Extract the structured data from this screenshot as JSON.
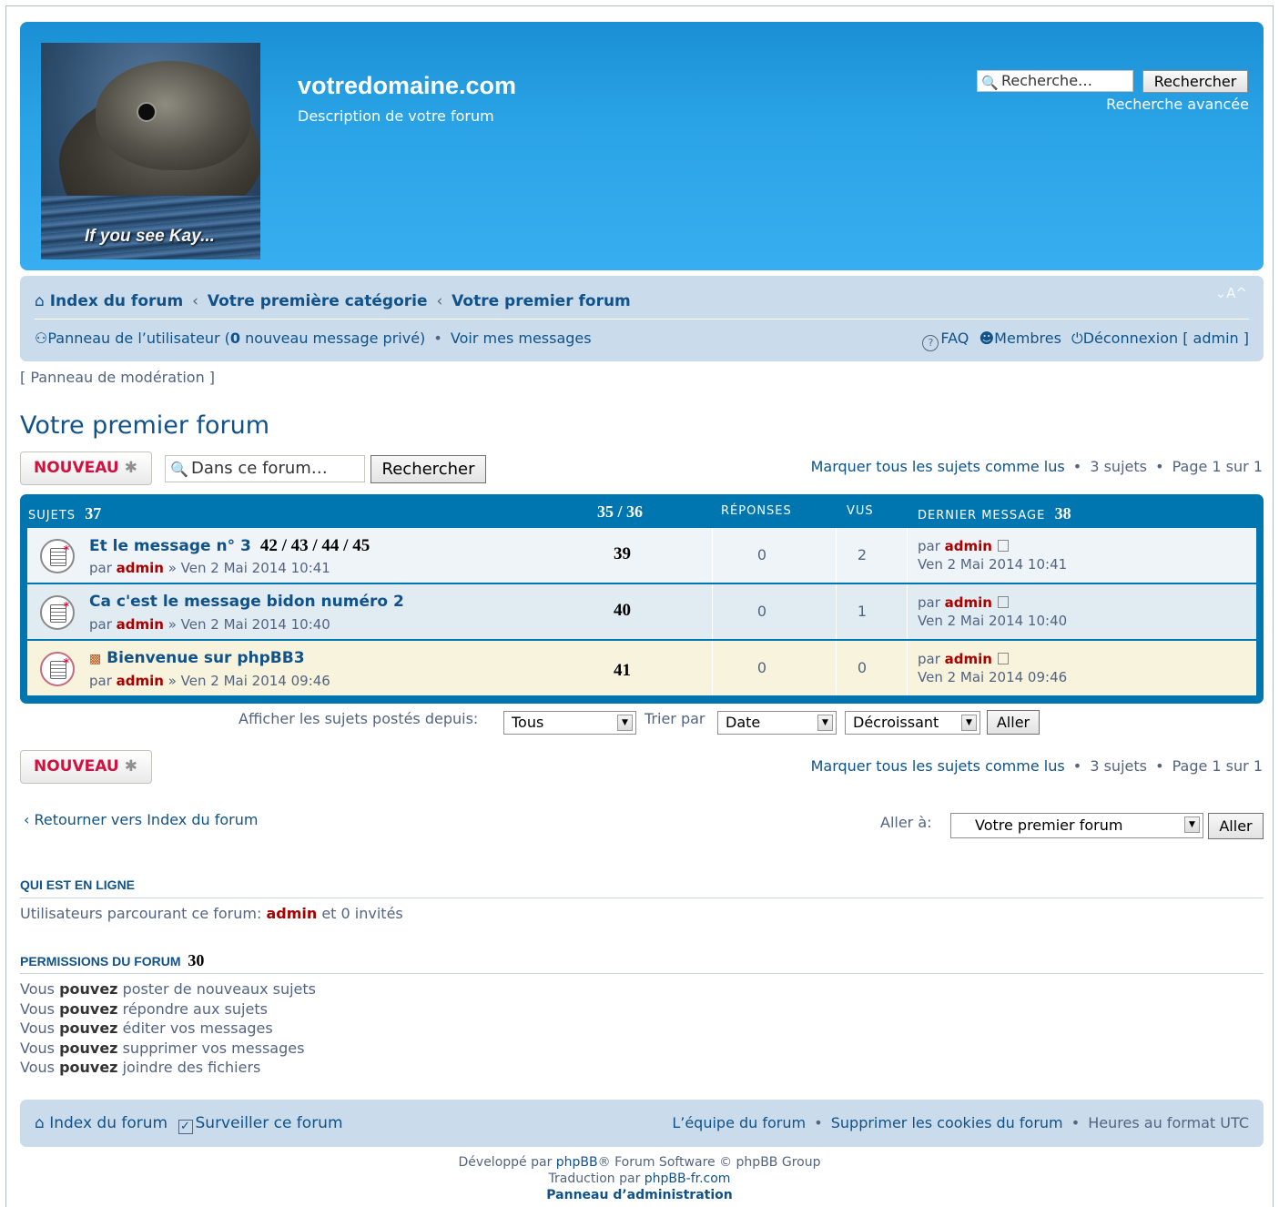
{
  "header": {
    "site_title": "votredomaine.com",
    "site_description": "Description de votre forum",
    "logo_caption": "If you see Kay...",
    "search_placeholder": "Recherche…",
    "search_button": "Rechercher",
    "advanced_search": "Recherche avancée"
  },
  "breadcrumbs": [
    "Index du forum",
    "Votre première catégorie",
    "Votre premier forum"
  ],
  "font_size_control": "⌄A^",
  "navbar": {
    "user_panel": "Panneau de l’utilisateur (",
    "pm_count": "0",
    "pm_text": " nouveau message privé)",
    "my_posts": "Voir mes messages",
    "faq": "FAQ",
    "members": "Membres",
    "logout": "Déconnexion [ admin ]"
  },
  "moderation_panel": "[ Panneau de modération ]",
  "forum": {
    "title": "Votre premier forum",
    "new_button": "NOUVEAU",
    "search_placeholder": "Dans ce forum…",
    "search_button": "Rechercher",
    "mark_read": "Marquer tous les sujets comme lus",
    "topics_count": "3 sujets",
    "page_info": "Page 1 sur 1"
  },
  "table": {
    "col_topics": "SUJETS",
    "col_topics_num": "37",
    "col_pages": "35 / 36",
    "col_replies": "RÉPONSES",
    "col_views": "VUS",
    "col_last": "DERNIER MESSAGE",
    "col_last_num": "38",
    "rows": [
      {
        "title": "Et le message n° 3",
        "pages": "42 / 43 / 44 / 45",
        "by": "par ",
        "author": "admin",
        "date": " » Ven 2 Mai 2014 10:41",
        "num": "39",
        "replies": "0",
        "views": "2",
        "last_by": "par ",
        "last_author": "admin",
        "last_date": "Ven 2 Mai 2014 10:41"
      },
      {
        "title": "Ca c'est le message bidon numéro 2",
        "pages": "",
        "by": "par ",
        "author": "admin",
        "date": " » Ven 2 Mai 2014 10:40",
        "num": "40",
        "replies": "0",
        "views": "1",
        "last_by": "par ",
        "last_author": "admin",
        "last_date": "Ven 2 Mai 2014 10:40"
      },
      {
        "title": "Bienvenue sur phpBB3",
        "pages": "",
        "by": "par ",
        "author": "admin",
        "date": " » Ven 2 Mai 2014 09:46",
        "num": "41",
        "replies": "0",
        "views": "0",
        "last_by": "par ",
        "last_author": "admin",
        "last_date": "Ven 2 Mai 2014 09:46"
      }
    ]
  },
  "sorting": {
    "show_since_label": "Afficher les sujets postés depuis:",
    "show_since_value": "Tous",
    "sort_by_label": "Trier par",
    "sort_by_value": "Date",
    "order_value": "Décroissant",
    "go_button": "Aller"
  },
  "back_link": "Retourner vers Index du forum",
  "jump": {
    "label": "Aller à:",
    "value": "Votre premier forum",
    "button": "Aller"
  },
  "who_online": {
    "title": "QUI EST EN LIGNE",
    "text_before": "Utilisateurs parcourant ce forum: ",
    "user": "admin",
    "text_after": " et 0 invités"
  },
  "permissions": {
    "title": "PERMISSIONS DU FORUM",
    "title_num": "30",
    "items": [
      {
        "prefix": "Vous ",
        "bold": "pouvez",
        "rest": " poster de nouveaux sujets"
      },
      {
        "prefix": "Vous ",
        "bold": "pouvez",
        "rest": " répondre aux sujets"
      },
      {
        "prefix": "Vous ",
        "bold": "pouvez",
        "rest": " éditer vos messages"
      },
      {
        "prefix": "Vous ",
        "bold": "pouvez",
        "rest": " supprimer vos messages"
      },
      {
        "prefix": "Vous ",
        "bold": "pouvez",
        "rest": " joindre des fichiers"
      }
    ]
  },
  "footer": {
    "index": "Index du forum",
    "watch": "Surveiller ce forum",
    "team": "L’équipe du forum",
    "delete_cookies": "Supprimer les cookies du forum",
    "timezone": "Heures au format UTC",
    "powered_prefix": "Développé par ",
    "phpbb": "phpBB",
    "powered_suffix": "® Forum Software © phpBB Group",
    "translation_prefix": "Traduction par ",
    "translation_link": "phpBB-fr.com",
    "admin_panel": "Panneau d’administration"
  },
  "colors": {
    "header_blue": "#2aa3e6",
    "nav_bg": "#cadceb",
    "table_header": "#0076b1",
    "link": "#105289",
    "author": "#aa0000",
    "new_button_text": "#d31141"
  }
}
